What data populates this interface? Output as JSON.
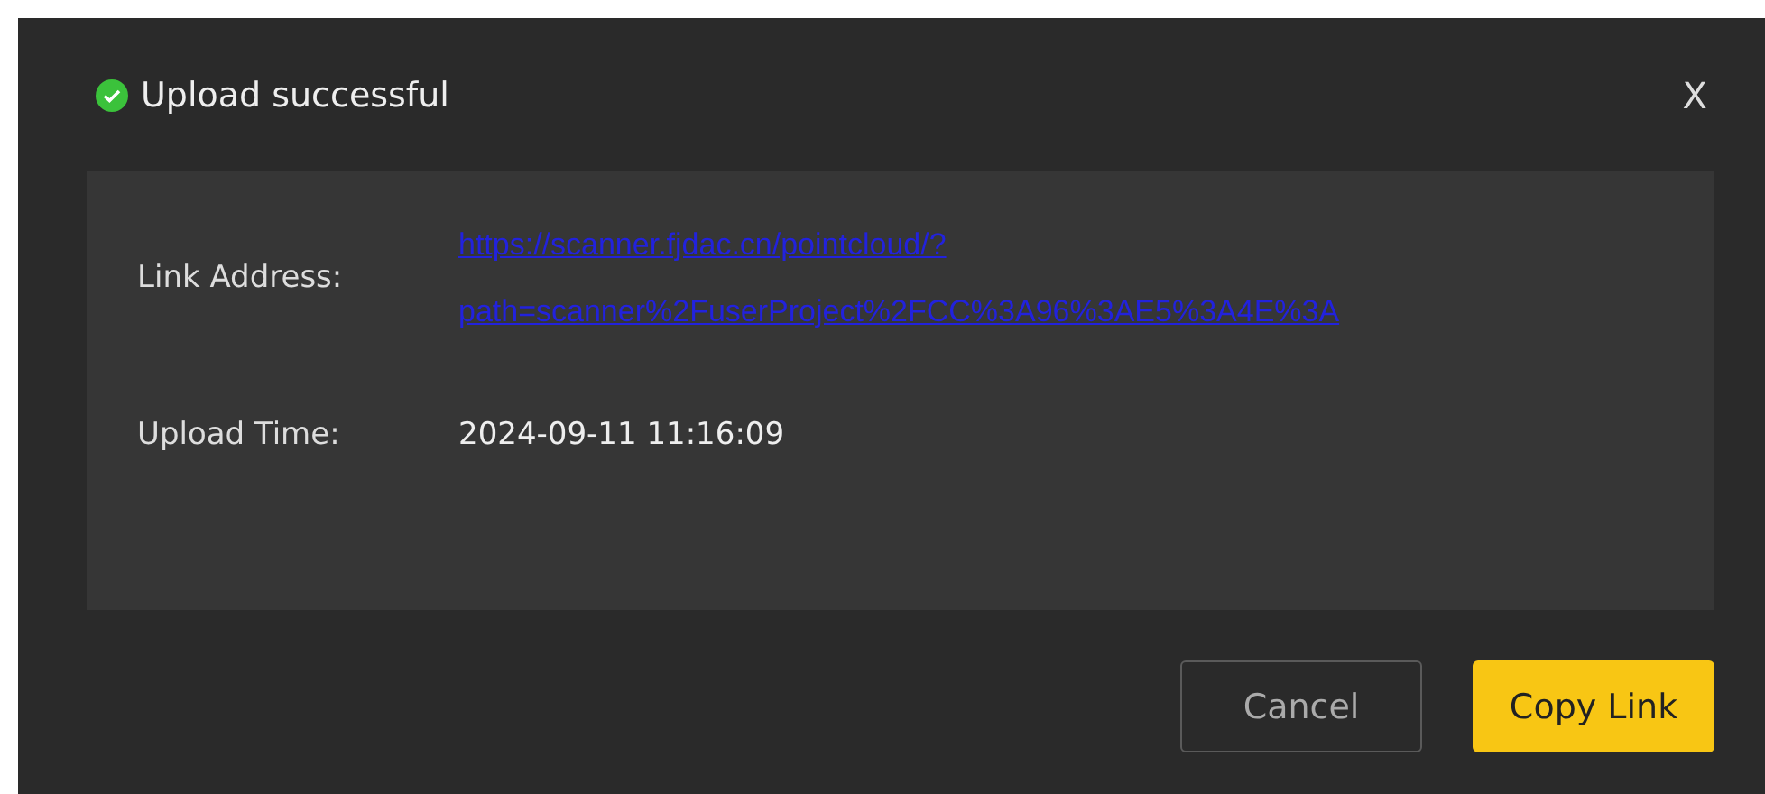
{
  "dialog": {
    "title": "Upload successful",
    "close": "X",
    "fields": [
      {
        "kind": "link",
        "label": "Link Address:",
        "value": "https://scanner.fjdac.cn/pointcloud/?path=scanner%2FuserProject%2FCC%3A96%3AE5%3A4E%3A"
      },
      {
        "kind": "text",
        "label": "Upload Time:",
        "value": "2024-09-11 11:16:09"
      }
    ],
    "buttons": [
      {
        "label": "Cancel",
        "kind": "secondary"
      },
      {
        "label": "Copy Link",
        "kind": "primary"
      }
    ]
  }
}
